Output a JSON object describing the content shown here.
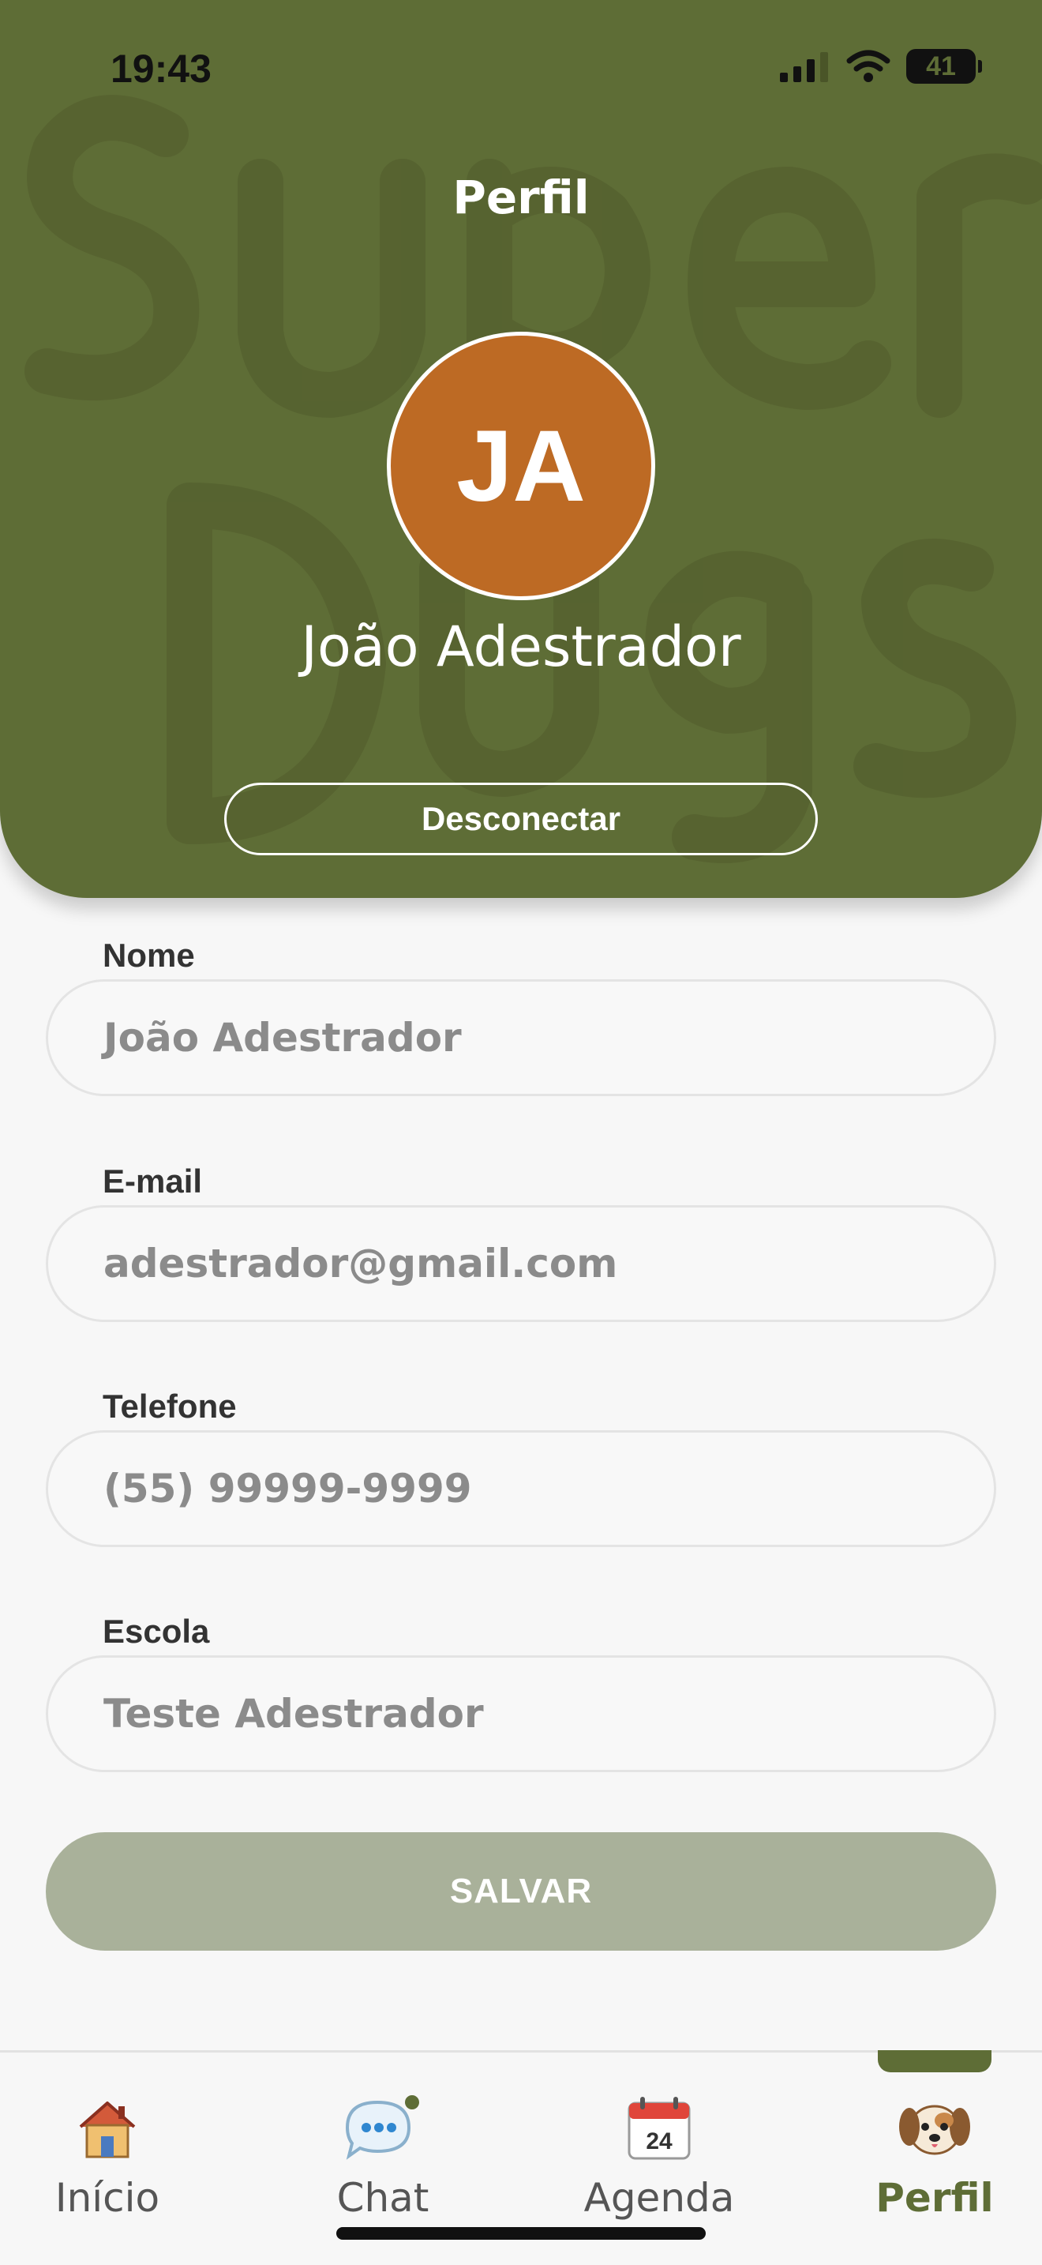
{
  "status_bar": {
    "time": "19:43",
    "battery": "41"
  },
  "header": {
    "title": "Perfil",
    "avatar_initials": "JA",
    "user_name": "João Adestrador",
    "logout_label": "Desconectar",
    "watermark_text": "SuperDogs"
  },
  "form": {
    "fields": [
      {
        "label": "Nome",
        "value": "João Adestrador"
      },
      {
        "label": "E-mail",
        "value": "adestrador@gmail.com"
      },
      {
        "label": "Telefone",
        "value": "(55) 99999-9999"
      },
      {
        "label": "Escola",
        "value": "Teste Adestrador"
      }
    ],
    "save_label": "SALVAR"
  },
  "tabs": [
    {
      "label": "Início",
      "icon": "house-icon"
    },
    {
      "label": "Chat",
      "icon": "chat-bubble-icon"
    },
    {
      "label": "Agenda",
      "icon": "calendar-icon",
      "calendar_day": "24"
    },
    {
      "label": "Perfil",
      "icon": "dog-icon",
      "active": true
    }
  ],
  "colors": {
    "header_green": "#5e6d36",
    "avatar_orange": "#bd6a24",
    "save_button": "#a9b19a",
    "background": "#f7f7f7"
  }
}
